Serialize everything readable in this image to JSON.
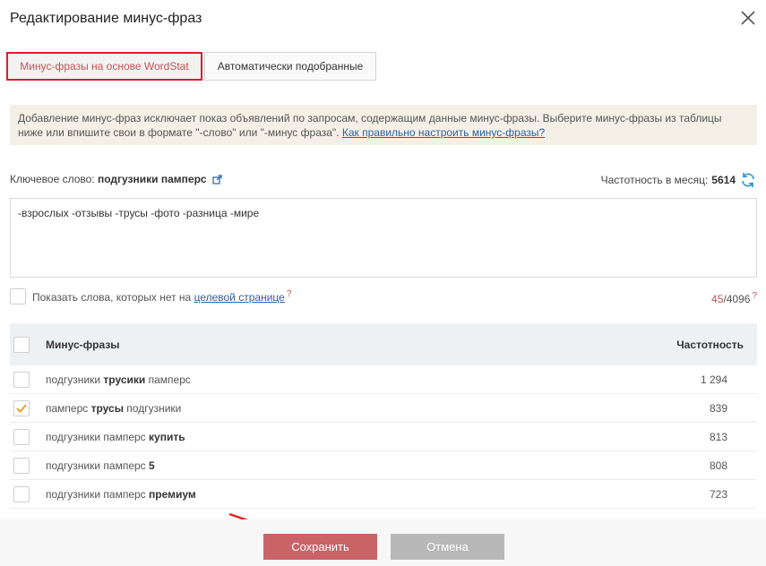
{
  "dialog": {
    "title": "Редактирование минус-фраз"
  },
  "tabs": [
    {
      "label": "Минус-фразы на основе WordStat",
      "active": true
    },
    {
      "label": "Автоматически подобранные",
      "active": false
    }
  ],
  "info": {
    "text": "Добавление минус-фраз исключает показ объявлений по запросам, содержащим данные минус-фразы. Выберите минус-фразы из таблицы ниже или впишите свои в формате \"-слово\" или \"-минус фраза\". ",
    "link": "Как правильно настроить минус-фразы?"
  },
  "keyword": {
    "label": "Ключевое слово:",
    "value": "подгузники памперс"
  },
  "frequency": {
    "label": "Частотность в месяц:",
    "value": "5614"
  },
  "minus_text": "-взрослых -отзывы -трусы -фото -разница -мире",
  "show_words": {
    "label": "Показать слова, которых нет на ",
    "link": "целевой странице",
    "hint": "?"
  },
  "counter": {
    "current": "45",
    "max": "/4096",
    "hint": "?"
  },
  "table": {
    "headers": {
      "phrase": "Минус-фразы",
      "freq": "Частотность"
    },
    "rows": [
      {
        "pre": "подгузники ",
        "bold": "трусики",
        "post": " памперс",
        "freq": "1 294",
        "checked": false
      },
      {
        "pre": "памперс ",
        "bold": "трусы",
        "post": " подгузники",
        "freq": "839",
        "checked": true
      },
      {
        "pre": "подгузники памперс ",
        "bold": "купить",
        "post": "",
        "freq": "813",
        "checked": false
      },
      {
        "pre": "подгузники памперс ",
        "bold": "5",
        "post": "",
        "freq": "808",
        "checked": false
      },
      {
        "pre": "подгузники памперс ",
        "bold": "премиум",
        "post": "",
        "freq": "723",
        "checked": false
      }
    ]
  },
  "buttons": {
    "save": "Сохранить",
    "cancel": "Отмена"
  },
  "colors": {
    "accent": "#c86468",
    "highlight_border": "#d81e2c",
    "check": "#f0a020",
    "link": "#2a62a7"
  }
}
